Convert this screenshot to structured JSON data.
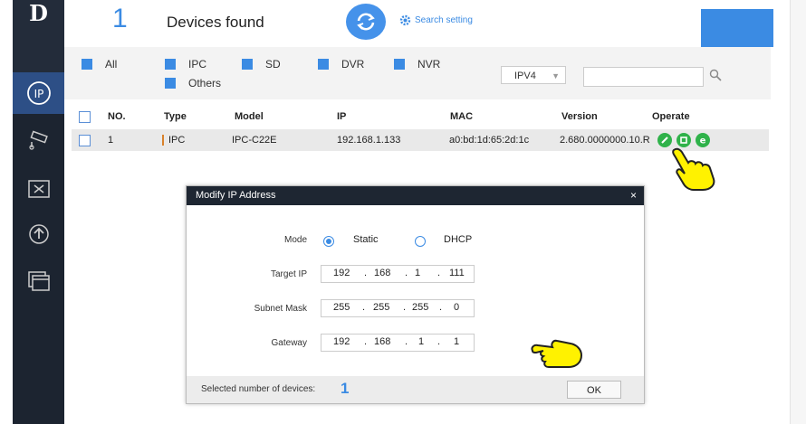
{
  "header": {
    "device_count": "1",
    "devices_found_label": "Devices found",
    "search_setting_label": "Search setting"
  },
  "filters": {
    "items": [
      "All",
      "IPC",
      "SD",
      "DVR",
      "NVR",
      "Others"
    ],
    "ip_version": "IPV4",
    "search_value": ""
  },
  "table": {
    "columns": [
      "NO.",
      "Type",
      "Model",
      "IP",
      "MAC",
      "Version",
      "Operate"
    ],
    "rows": [
      {
        "no": "1",
        "type": "IPC",
        "model": "IPC-C22E",
        "ip": "192.168.1.133",
        "mac": "a0:bd:1d:65:2d:1c",
        "version": "2.680.0000000.10.R"
      }
    ]
  },
  "dialog": {
    "title": "Modify IP Address",
    "close": "×",
    "mode_label": "Mode",
    "mode_static": "Static",
    "mode_dhcp": "DHCP",
    "target_ip_label": "Target IP",
    "target_ip": [
      "192",
      "168",
      "1",
      "111"
    ],
    "subnet_mask_label": "Subnet Mask",
    "subnet_mask": [
      "255",
      "255",
      "255",
      "0"
    ],
    "gateway_label": "Gateway",
    "gateway": [
      "192",
      "168",
      "1",
      "1"
    ],
    "ip_separator": ".",
    "selected_label": "Selected number of devices:",
    "selected_count": "1",
    "ok_label": "OK"
  },
  "colors": {
    "accent": "#3b8be3",
    "sidebar": "#1c2430",
    "operate_green": "#2fb24a"
  }
}
